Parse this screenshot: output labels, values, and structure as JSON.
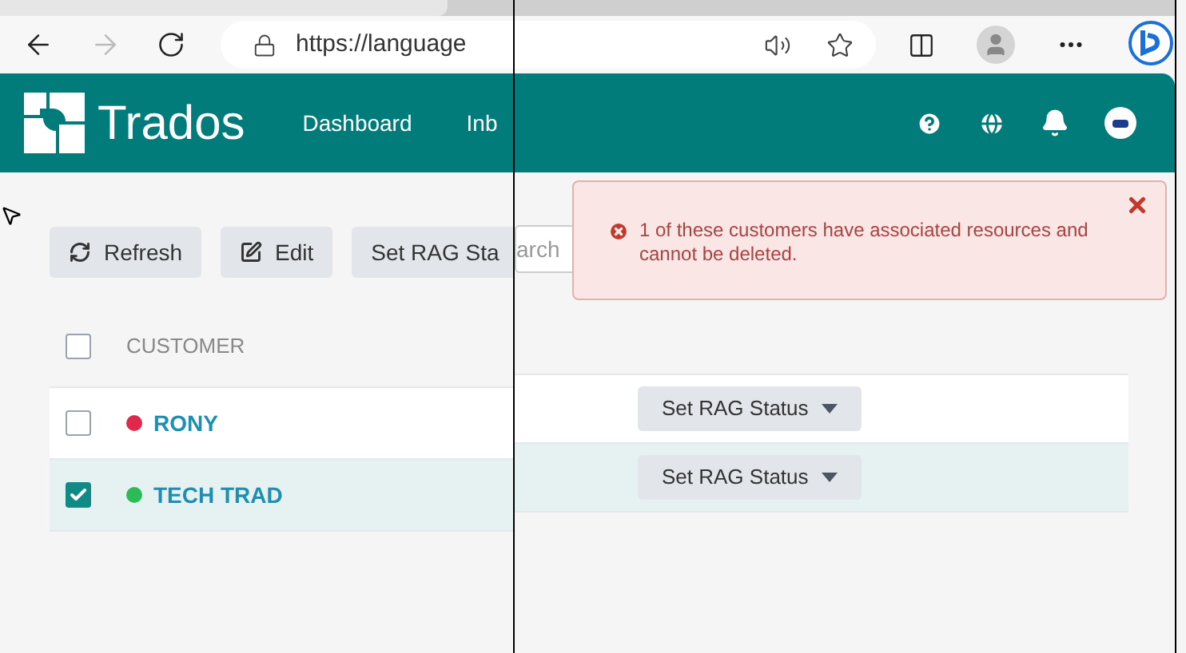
{
  "left": {
    "url": "https://language",
    "brand": "Trados",
    "nav": [
      "Dashboard",
      "Inb"
    ],
    "toolbar": [
      {
        "kind": "refresh",
        "label": "Refresh"
      },
      {
        "kind": "edit",
        "label": "Edit"
      },
      {
        "kind": "plain",
        "label": "Set RAG Sta"
      }
    ],
    "table": {
      "header_checked": false,
      "columns": [
        "CUSTOMER"
      ],
      "rows": [
        {
          "name": "RONY",
          "color": "#e0284a",
          "checked": false
        },
        {
          "name": "TECH TRAD",
          "color": "#2dbb55",
          "checked": true
        }
      ]
    }
  },
  "right": {
    "search": {
      "value": "arch"
    },
    "alert": {
      "message": "1 of these customers have associated resources and cannot be deleted."
    },
    "rows": [
      {
        "action": "Set RAG Status",
        "selected": false
      },
      {
        "action": "Set RAG Status",
        "selected": true
      }
    ]
  }
}
